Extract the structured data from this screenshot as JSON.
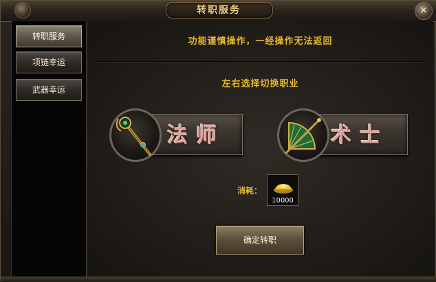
{
  "window": {
    "title": "转职服务",
    "close_symbol": "×"
  },
  "sidebar": {
    "items": [
      {
        "label": "转职服务",
        "active": true
      },
      {
        "label": "项链幸运",
        "active": false
      },
      {
        "label": "武器幸运",
        "active": false
      }
    ]
  },
  "main": {
    "warning": "功能谨慎操作，一经操作无法返回",
    "switch_hint": "左右选择切换职业",
    "classes": [
      {
        "label": "法师",
        "icon": "staff-icon"
      },
      {
        "label": "术士",
        "icon": "fan-sword-icon"
      }
    ],
    "cost": {
      "label": "消耗：",
      "item_icon": "gold-ingot-icon",
      "quantity": "10000"
    },
    "confirm_label": "确定转职"
  },
  "colors": {
    "gold_text": "#e8b830",
    "title_text": "#f0cf86",
    "class_label": "#d8a8a0"
  }
}
